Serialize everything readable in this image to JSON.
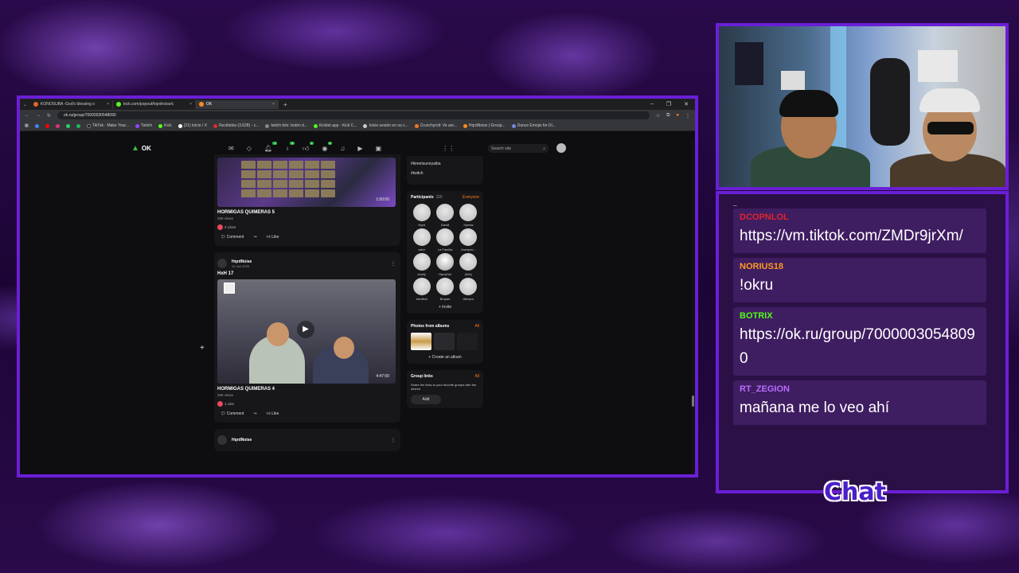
{
  "browser": {
    "tabs": [
      {
        "title": "KONOSUBA -God's blessing o",
        "color": "#e8642c",
        "active": false
      },
      {
        "title": "kick.com/popout/hqrdnoise/c",
        "color": "#53fc18",
        "active": false
      },
      {
        "title": "OK",
        "color": "#ff8a1f",
        "active": true
      }
    ],
    "url": "ok.ru/group/70000030548090",
    "bookmarks": [
      {
        "label": "TikTok - Make Your...",
        "color": "#111"
      },
      {
        "label": "Twitch",
        "color": "#9146ff"
      },
      {
        "label": "Kick",
        "color": "#53fc18"
      },
      {
        "label": "(21) Inicio / X",
        "color": "#fff"
      },
      {
        "label": "Recibidos (3.628) - c...",
        "color": "#d93025"
      },
      {
        "label": "twitch bits: botón d...",
        "color": "#888"
      },
      {
        "label": "Kicklet.app - Kick C...",
        "color": "#53fc18"
      },
      {
        "label": "Inicie sesión en su c...",
        "color": "#ccc"
      },
      {
        "label": "Crunchyroll: Ve ani...",
        "color": "#f47521"
      },
      {
        "label": "HqrdNoise | Group...",
        "color": "#ff8a1f"
      },
      {
        "label": "Dance Emojis for Di...",
        "color": "#7289da"
      }
    ]
  },
  "site": {
    "logo": "OK",
    "search_placeholder": "Search site",
    "badges": [
      "1",
      "3",
      "1",
      "2"
    ]
  },
  "feed": {
    "post1": {
      "title": "HORMIGAS QUIMERAS 5",
      "views": "259 views",
      "likes": "2 Likes",
      "duration": "1:00:00"
    },
    "post2": {
      "author": "HqrdNoise",
      "date": "15 Jan 2025",
      "caption": "HxH 17",
      "title": "HORMIGAS QUIMERAS 4",
      "views": "298 views",
      "likes": "1 Like",
      "duration": "4:47:00"
    },
    "post3": {
      "author": "HqrdNoise"
    },
    "actions": {
      "comment": "Comment",
      "like": "Like"
    }
  },
  "side": {
    "tags": [
      "#kimetsunoyaiba",
      "#twitch"
    ],
    "participants": {
      "title": "Participants",
      "count": "115",
      "filter": "Everyone",
      "members": [
        "Hqrd",
        "David",
        "Xpress",
        "vater",
        "La Familia",
        "Unexpec...",
        "charly",
        "HarryHol",
        "jhbhj",
        "Jamilton",
        "Brayan",
        "Albeyro"
      ],
      "invite": "Invite"
    },
    "photos": {
      "title": "Photos from albums",
      "all": "All",
      "create": "Create an album"
    },
    "links": {
      "title": "Group links",
      "all": "All",
      "desc": "Share the links to your favorite groups with the others!",
      "add": "Add"
    }
  },
  "chat": {
    "title": "Chat",
    "top_fragment": "_",
    "messages": [
      {
        "user": "DCOPNLOL",
        "color": "#e0242c",
        "text": "https://vm.tiktok.com/ZMDr9jrXm/"
      },
      {
        "user": "NORIUS18",
        "color": "#ff9a1f",
        "text": "!okru"
      },
      {
        "user": "BOTRIX",
        "color": "#53fc18",
        "text": "https://ok.ru/group/70000030548090"
      },
      {
        "user": "RT_ZEGION",
        "color": "#b86cff",
        "text": "mañana me lo veo ahí"
      }
    ]
  }
}
